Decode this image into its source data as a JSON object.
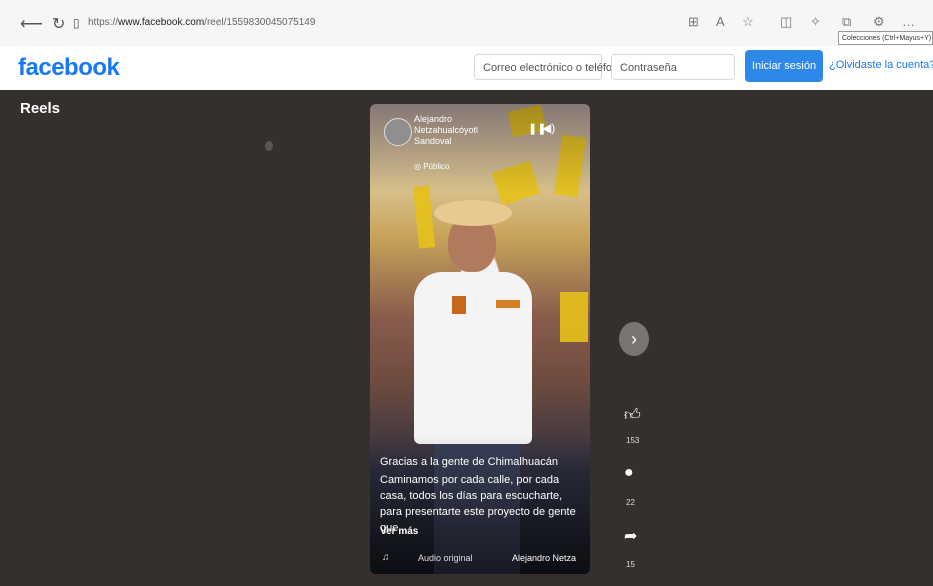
{
  "browser": {
    "url_prefix": "https://",
    "url_host": "www.facebook.com",
    "url_path": "/reel/1559830045075149",
    "tooltip": "Colecciones (Ctrl+Mayus+Y)"
  },
  "header": {
    "logo": "facebook",
    "email_placeholder": "Correo electrónico o teléfono",
    "password_placeholder": "Contraseña",
    "login_label": "Iniciar sesión",
    "forgot_label": "¿Olvidaste la cuenta?"
  },
  "reels": {
    "title": "Reels"
  },
  "video": {
    "author": "Alejandro Netzahualcóyotl Sandoval",
    "visibility": "Público",
    "caption_title": "Gracias a la gente de Chimalhuacán",
    "caption": "Caminamos por cada calle, por cada casa, todos los días para escucharte, para presentarte este proyecto de gente que...",
    "see_more": "Ver más",
    "audio_label": "Audio original",
    "author_short": "Alejandro Netza"
  },
  "actions": {
    "likes": "153",
    "comments": "22",
    "shares": "15"
  },
  "colors": {
    "brand": "#1877f2",
    "login_button": "#2d88e8",
    "reels_background": "#35302e"
  }
}
